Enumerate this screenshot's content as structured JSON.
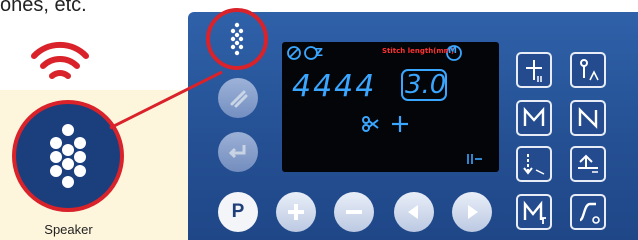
{
  "caption_top": "ones, etc.",
  "speaker": {
    "label": "Speaker"
  },
  "lcd": {
    "stitch_length_label": "Stitch length(mm)",
    "digits": "4444",
    "value": "3.0"
  },
  "buttons": {
    "p_label": "P"
  },
  "colors": {
    "panel": "#2a5aa0",
    "accent_red": "#d9222a",
    "lcd_red": "#ff2a2a",
    "lcd_cyan": "#3aa6ff",
    "icon_white": "#ffffff"
  },
  "icons": [
    "wifi-icon",
    "speaker-icon",
    "slash-icon",
    "enter-icon",
    "plus-icon",
    "minus-icon",
    "left-arrow-icon",
    "right-arrow-icon",
    "presser-foot-icon",
    "needle-position-icon",
    "pattern-ab-icon",
    "pattern-cd-icon",
    "thread-trim-icon",
    "counter-icon",
    "stitch-curve-icon",
    "scissors-icon",
    "m-mode-icon"
  ]
}
